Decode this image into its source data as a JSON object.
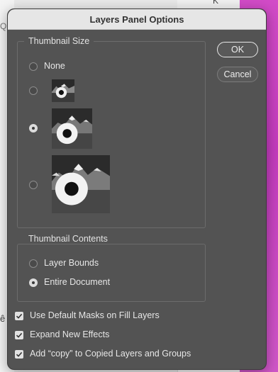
{
  "background": {
    "left_text": "Q",
    "lower_text": "ê",
    "top_text": "K"
  },
  "dialog": {
    "title": "Layers Panel Options",
    "thumbnail_size": {
      "title": "Thumbnail Size",
      "options": [
        {
          "label": "None",
          "selected": false
        },
        {
          "label": "",
          "selected": false
        },
        {
          "label": "",
          "selected": true
        },
        {
          "label": "",
          "selected": false
        }
      ]
    },
    "thumbnail_contents": {
      "title": "Thumbnail Contents",
      "options": [
        {
          "label": "Layer Bounds",
          "selected": false
        },
        {
          "label": "Entire Document",
          "selected": true
        }
      ]
    },
    "checkboxes": [
      {
        "label": "Use Default Masks on Fill Layers",
        "checked": true
      },
      {
        "label": "Expand New Effects",
        "checked": true
      },
      {
        "label": "Add “copy” to Copied Layers and Groups",
        "checked": true
      }
    ],
    "buttons": {
      "ok": "OK",
      "cancel": "Cancel"
    }
  },
  "colors": {
    "dialog_bg": "#535353",
    "titlebar_bg": "#e6e6e6",
    "magenta_bg": "#d24bc7"
  }
}
